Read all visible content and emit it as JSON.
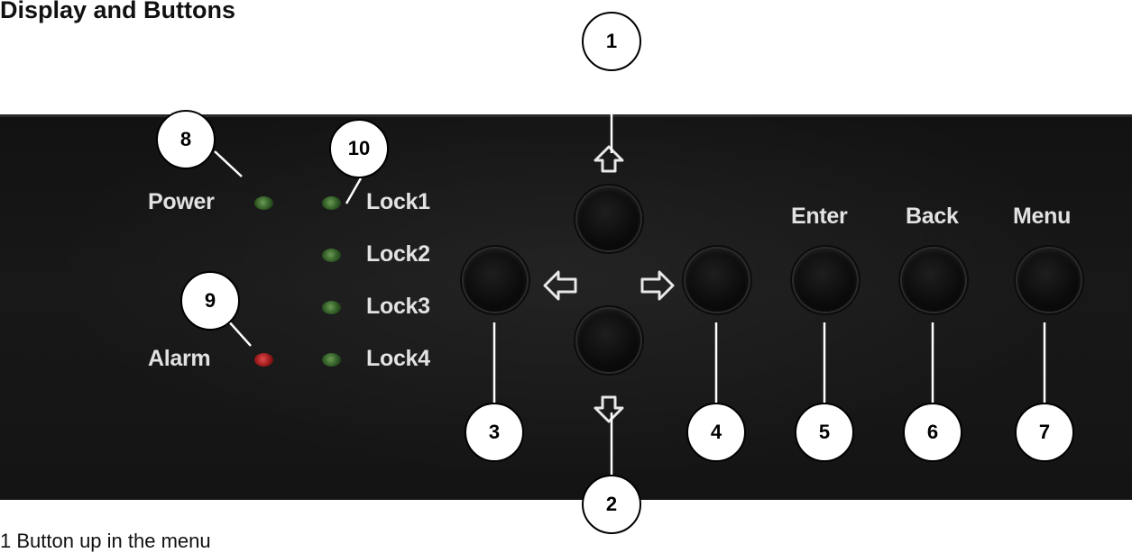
{
  "title": "Display and Buttons",
  "panel": {
    "indicators": {
      "power": "Power",
      "alarm": "Alarm",
      "lock1": "Lock1",
      "lock2": "Lock2",
      "lock3": "Lock3",
      "lock4": "Lock4"
    },
    "buttons": {
      "enter": "Enter",
      "back": "Back",
      "menu": "Menu"
    },
    "colors": {
      "led_green": "#3a6a2c",
      "led_red": "#b01e1e",
      "panel": "#151515"
    }
  },
  "callouts": [
    "1",
    "2",
    "3",
    "4",
    "5",
    "6",
    "7",
    "8",
    "9",
    "10"
  ],
  "caption": "1   Button up in the menu"
}
